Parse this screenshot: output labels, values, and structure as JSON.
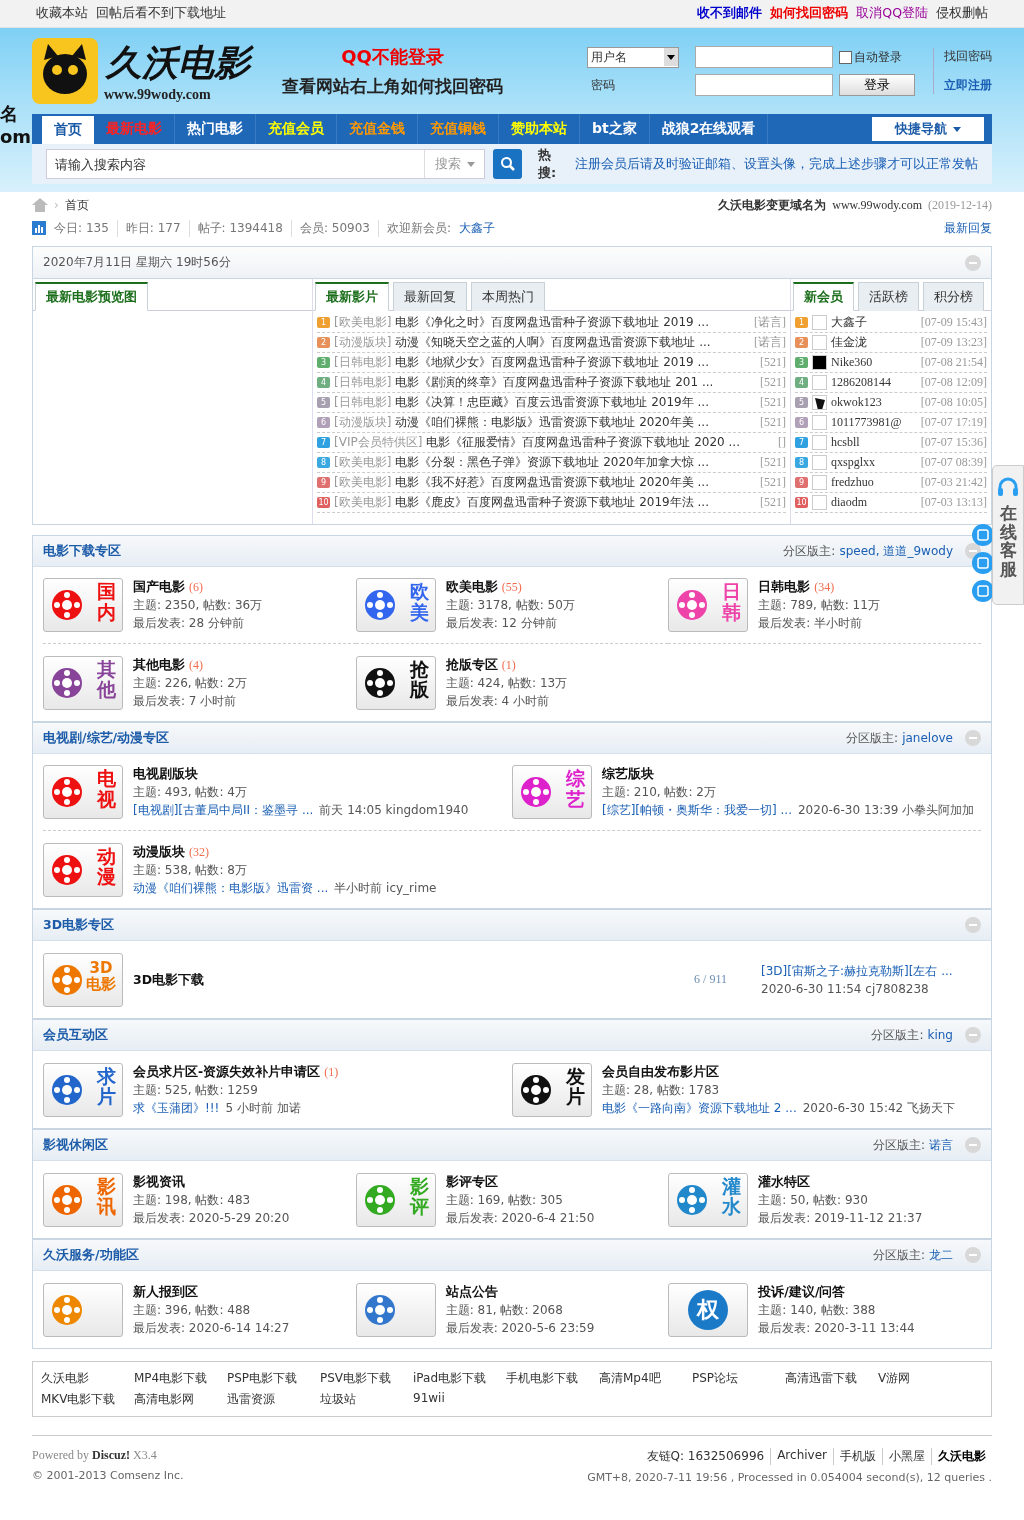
{
  "edge_fragments": [
    "名",
    "om"
  ],
  "topbar": {
    "left": [
      "收藏本站",
      "回帖后看不到下载地址"
    ],
    "right": [
      {
        "label": "收不到邮件",
        "color": "#0000cc"
      },
      {
        "label": "如何找回密码",
        "color": "#ee0000"
      },
      {
        "label": "取消QQ登陆",
        "color": "#990099"
      },
      {
        "label": "侵权删帖",
        "color": "#333333"
      }
    ]
  },
  "header": {
    "logo_text": "久沃电影",
    "logo_url": "www.99wody.com",
    "notice": [
      "QQ不能登录",
      "查看网站右上角如何找回密码"
    ],
    "login": {
      "user_select": "用户名",
      "password_label": "密码",
      "remember": {
        "label": "自动登录",
        "checked": false
      },
      "submit": "登录",
      "links": [
        "找回密码",
        "立即注册"
      ]
    }
  },
  "nav": {
    "items": [
      {
        "label": "首页",
        "kind": "home",
        "selected": true
      },
      {
        "label": "最新电影",
        "kind": "alert",
        "selected": false
      },
      {
        "label": "热门电影",
        "kind": "plain",
        "selected": false
      },
      {
        "label": "充值会员",
        "kind": "promo",
        "selected": false
      },
      {
        "label": "充值金钱",
        "kind": "pay",
        "selected": false
      },
      {
        "label": "充值铜钱",
        "kind": "pay",
        "selected": false
      },
      {
        "label": "赞助本站",
        "kind": "promo",
        "selected": false
      },
      {
        "label": "bt之家",
        "kind": "plain",
        "selected": false
      },
      {
        "label": "战狼2在线观看",
        "kind": "plain",
        "selected": false
      }
    ],
    "quick": "快捷导航"
  },
  "search": {
    "placeholder": "请输入搜索内容",
    "type": "搜索",
    "hot_label": "热搜:",
    "hot_text": "注册会员后请及时验证邮箱、设置头像，完成上述步骤才可以正常发帖"
  },
  "breadcrumb": {
    "separator": "›",
    "home": "首页",
    "notice": "久沃电影变更域名为",
    "domain": "www.99wody.com",
    "date": "(2019-12-14)"
  },
  "stats": {
    "items": [
      {
        "label": "今日:",
        "value": "135"
      },
      {
        "label": "昨日:",
        "value": "177"
      },
      {
        "label": "帖子:",
        "value": "1394418"
      },
      {
        "label": "会员:",
        "value": "50903"
      }
    ],
    "welcome": "欢迎新会员:",
    "new_member": "大鑫子",
    "latest": "最新回复"
  },
  "portal": {
    "date": "2020年7月11日 星期六 19时56分",
    "preview_tab": "最新电影预览图",
    "thread_tabs": [
      {
        "label": "最新影片",
        "selected": true
      },
      {
        "label": "最新回复",
        "selected": false
      },
      {
        "label": "本周热门",
        "selected": false
      }
    ],
    "threads": [
      {
        "num": "1",
        "color": "#f0a030",
        "category": "[欧美电影]",
        "title": "电影《净化之时》百度网盘迅雷种子资源下载地址 2019 ...",
        "tail": "[诺言]"
      },
      {
        "num": "2",
        "color": "#e8905a",
        "category": "[动漫版块]",
        "title": "动漫《知晓天空之蓝的人啊》百度网盘迅雷资源下载地址 ...",
        "tail": "[诺言]"
      },
      {
        "num": "3",
        "color": "#5fae6e",
        "category": "[日韩电影]",
        "title": "电影《地狱少女》百度网盘迅雷种子资源下载地址 2019 ...",
        "tail": "[521]"
      },
      {
        "num": "4",
        "color": "#6fae80",
        "category": "[日韩电影]",
        "title": "电影《剧演的终章》百度网盘迅雷种子资源下载地址 201 ...",
        "tail": "[521]"
      },
      {
        "num": "5",
        "color": "#a8a0b0",
        "category": "[日韩电影]",
        "title": "电影《决算！忠臣藏》百度云迅雷资源下载地址 2019年 ...",
        "tail": "[521]"
      },
      {
        "num": "6",
        "color": "#b0a0b8",
        "category": "[动漫版块]",
        "title": "动漫《咱们裸熊：电影版》迅雷资源下载地址 2020年美 ...",
        "tail": "[521]"
      },
      {
        "num": "7",
        "color": "#2fa0e0",
        "category": "[VIP会员特供区]",
        "title": "电影《征服爱情》百度网盘迅雷种子资源下载地址 2020 ...",
        "tail": "[]"
      },
      {
        "num": "8",
        "color": "#3aa8e0",
        "category": "[欧美电影]",
        "title": "电影《分裂：黑色子弹》资源下载地址 2020年加拿大惊 ...",
        "tail": "[521]"
      },
      {
        "num": "9",
        "color": "#e07070",
        "category": "[欧美电影]",
        "title": "电影《我不好惹》百度网盘迅雷资源下载地址 2020年美 ...",
        "tail": "[521]"
      },
      {
        "num": "10",
        "color": "#e06060",
        "category": "[欧美电影]",
        "title": "电影《鹿皮》百度网盘迅雷种子资源下载地址 2019年法 ...",
        "tail": "[521]"
      }
    ],
    "member_tabs": [
      {
        "label": "新会员",
        "selected": true
      },
      {
        "label": "活跃榜",
        "selected": false
      },
      {
        "label": "积分榜",
        "selected": false
      }
    ],
    "members": [
      {
        "num": "1",
        "color": "#f0a030",
        "kind": "blank",
        "name": "大鑫子",
        "time": "[07-09 15:43]"
      },
      {
        "num": "2",
        "color": "#e8905a",
        "kind": "blank",
        "name": "佳金泷",
        "time": "[07-09 13:23]"
      },
      {
        "num": "3",
        "color": "#5fae6e",
        "kind": "dark",
        "name": "Nike360",
        "time": "[07-08 21:54]"
      },
      {
        "num": "4",
        "color": "#6fae80",
        "kind": "blank",
        "name": "1286208144",
        "time": "[07-08 12:09]"
      },
      {
        "num": "5",
        "color": "#a8a0b0",
        "kind": "figure",
        "name": "okwok123",
        "time": "[07-08 10:05]"
      },
      {
        "num": "6",
        "color": "#b0a0b8",
        "kind": "blank",
        "name": "1011773981@",
        "time": "[07-07 17:19]"
      },
      {
        "num": "7",
        "color": "#2fa0e0",
        "kind": "blank",
        "name": "hcsbll",
        "time": "[07-07 15:36]"
      },
      {
        "num": "8",
        "color": "#3aa8e0",
        "kind": "blank",
        "name": "qxspglxx",
        "time": "[07-07 08:39]"
      },
      {
        "num": "9",
        "color": "#e07070",
        "kind": "blank",
        "name": "fredzhuo",
        "time": "[07-03 21:42]"
      },
      {
        "num": "10",
        "color": "#e06060",
        "kind": "blank",
        "name": "diaodm",
        "time": "[07-03 13:13]"
      }
    ]
  },
  "categories": [
    {
      "title": "电影下载专区",
      "mod_label": "分区版主:",
      "mods": [
        "speed,",
        "道道_9wody"
      ],
      "kind": "three",
      "forums": [
        {
          "name": "国产电影",
          "count": "(6)",
          "badge": "国内",
          "kind": "stack",
          "color": "#ee1111",
          "stats": "主题: 2350, 帖数: 36万",
          "last": {
            "kind": "time",
            "text": "最后发表: 28 分钟前"
          }
        },
        {
          "name": "欧美电影",
          "count": "(55)",
          "badge": "欧美",
          "kind": "stack",
          "color": "#3366ee",
          "stats": "主题: 3178, 帖数: 50万",
          "last": {
            "kind": "time",
            "text": "最后发表: 12 分钟前"
          }
        },
        {
          "name": "日韩电影",
          "count": "(34)",
          "badge": "日韩",
          "kind": "stack",
          "color": "#ee44aa",
          "stats": "主题: 789, 帖数: 11万",
          "last": {
            "kind": "time",
            "text": "最后发表: 半小时前"
          }
        },
        {
          "name": "其他电影",
          "count": "(4)",
          "badge": "其他",
          "kind": "stack",
          "color": "#884499",
          "stats": "主题: 226, 帖数: 2万",
          "last": {
            "kind": "time",
            "text": "最后发表: 7 小时前"
          }
        },
        {
          "name": "抢版专区",
          "count": "(1)",
          "badge": "抢版",
          "kind": "stack",
          "color": "#111111",
          "stats": "主题: 424, 帖数: 13万",
          "last": {
            "kind": "time",
            "text": "最后发表: 4 小时前"
          }
        }
      ]
    },
    {
      "title": "电视剧/综艺/动漫专区",
      "mod_label": "分区版主:",
      "mods": [
        "janelove"
      ],
      "kind": "two",
      "forums": [
        {
          "name": "电视剧版块",
          "badge": "电视",
          "kind": "stack",
          "color": "#ee1111",
          "stats": "主题: 493, 帖数: 4万",
          "last": {
            "kind": "thread",
            "link": "[电视剧][古董局中局II：鉴墨寻 ...",
            "meta": "前天 14:05 kingdom1940"
          }
        },
        {
          "name": "综艺版块",
          "badge": "综艺",
          "kind": "stack",
          "color": "#dd22cc",
          "stats": "主题: 210, 帖数: 2万",
          "last": {
            "kind": "thread",
            "link": "[综艺][帕顿・奥斯华：我爱一切] ...",
            "meta": "2020-6-30 13:39 小拳头阿加加"
          }
        },
        {
          "name": "动漫版块",
          "count": "(32)",
          "badge": "动漫",
          "kind": "stack",
          "color": "#ee1111",
          "stats": "主题: 538, 帖数: 8万",
          "last": {
            "kind": "thread",
            "link": "动漫《咱们裸熊：电影版》迅雷资 ...",
            "meta": "半小时前 icy_rime"
          }
        }
      ]
    },
    {
      "title": "3D电影专区",
      "kind": "wide",
      "forums": [
        {
          "name": "3D电影下载",
          "badge": "3D电影",
          "kind": "stack",
          "color": "#ee7700",
          "counts": "6 / 911",
          "last": {
            "kind": "thread",
            "link": "[3D][宙斯之子:赫拉克勒斯][左右 ...",
            "meta": "2020-6-30 11:54 cj7808238"
          }
        }
      ]
    },
    {
      "title": "会员互动区",
      "mod_label": "分区版主:",
      "mods": [
        "king"
      ],
      "kind": "two",
      "forums": [
        {
          "name": "会员求片区-资源失效补片申请区",
          "count": "(1)",
          "badge": "求片",
          "kind": "stack",
          "color": "#2266cc",
          "stats": "主题: 525, 帖数: 1259",
          "last": {
            "kind": "thread",
            "link": "求《玉蒲团》!!!",
            "meta": "5 小时前 加诺"
          }
        },
        {
          "name": "会员自由发布影片区",
          "badge": "发片",
          "kind": "stack",
          "color": "#111111",
          "stats": "主题: 28, 帖数: 1783",
          "last": {
            "kind": "thread",
            "link": "电影《一路向南》资源下载地址 2 ...",
            "meta": "2020-6-30 15:42 飞扬天下"
          }
        }
      ]
    },
    {
      "title": "影视休闲区",
      "mod_label": "分区版主:",
      "mods": [
        "诺言"
      ],
      "kind": "three",
      "forums": [
        {
          "name": "影视资讯",
          "badge": "影讯",
          "kind": "stack",
          "color": "#ee6600",
          "stats": "主题: 198, 帖数: 483",
          "last": {
            "kind": "time",
            "text": "最后发表: 2020-5-29 20:20"
          }
        },
        {
          "name": "影评专区",
          "badge": "影评",
          "kind": "stack",
          "color": "#33aa22",
          "stats": "主题: 169, 帖数: 305",
          "last": {
            "kind": "time",
            "text": "最后发表: 2020-6-4 21:50"
          }
        },
        {
          "name": "灌水特区",
          "badge": "灌水",
          "kind": "stack",
          "color": "#2288cc",
          "stats": "主题: 50, 帖数: 930",
          "last": {
            "kind": "time",
            "text": "最后发表: 2019-11-12 21:37"
          }
        }
      ]
    },
    {
      "title": "久沃服务/功能区",
      "mod_label": "分区版主:",
      "mods": [
        "龙二"
      ],
      "kind": "three",
      "forums": [
        {
          "name": "新人报到区",
          "kind": "plain",
          "color": "#ee8800",
          "stats": "主题: 396, 帖数: 488",
          "last": {
            "kind": "time",
            "text": "最后发表: 2020-6-14 14:27"
          }
        },
        {
          "name": "站点公告",
          "kind": "plain",
          "color": "#3377cc",
          "stats": "主题: 81, 帖数: 2068",
          "last": {
            "kind": "time",
            "text": "最后发表: 2020-5-6 23:59"
          }
        },
        {
          "name": "投诉/建议/问答",
          "badge": "权",
          "kind": "circle",
          "color": "#1a7ac8",
          "stats": "主题: 140, 帖数: 388",
          "last": {
            "kind": "time",
            "text": "最后发表: 2020-3-11 13:44"
          }
        }
      ]
    }
  ],
  "friend_links": [
    "久沃电影",
    "MP4电影下载",
    "PSP电影下载",
    "PSV电影下载",
    "iPad电影下载",
    "手机电影下载",
    "高清Mp4吧",
    "PSP论坛",
    "高清迅雷下载",
    "V游网",
    "MKV电影下载",
    "高清电影网",
    "迅雷资源",
    "垃圾站",
    "91wii"
  ],
  "footer": {
    "powered": "Powered by",
    "brand": "Discuz!",
    "version": "X3.4",
    "copyright": "© 2001-2013 Comsenz Inc.",
    "links": [
      "友链Q: 1632506996",
      "Archiver",
      "手机版",
      "小黑屋",
      "久沃电影"
    ],
    "gmt": "GMT+8, 2020-7-11 19:56 , Processed in 0.054004 second(s), 12 queries ."
  },
  "service": {
    "label": "在线客服"
  }
}
